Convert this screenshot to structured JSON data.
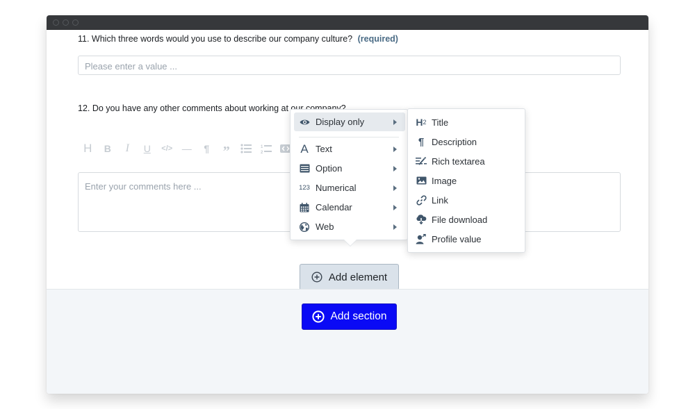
{
  "window": {
    "titlebar_dots": [
      "close",
      "minimize",
      "maximize"
    ]
  },
  "questions": [
    {
      "number_label": "11. Which three words would you use to describe our company culture?",
      "required_label": "(required)",
      "input_placeholder": "Please enter a value ..."
    },
    {
      "number_label": "12. Do you have any other comments about working at our company?",
      "textarea_placeholder": "Enter your comments here ..."
    }
  ],
  "editor_toolbar": [
    {
      "name": "heading",
      "glyph": "H"
    },
    {
      "name": "bold",
      "glyph": "B"
    },
    {
      "name": "italic",
      "glyph": "I"
    },
    {
      "name": "underline",
      "glyph": "U"
    },
    {
      "name": "code",
      "glyph": "</>"
    },
    {
      "name": "horizontal-rule",
      "glyph": "—"
    },
    {
      "name": "paragraph",
      "glyph": "¶"
    },
    {
      "name": "quote",
      "glyph": "”"
    },
    {
      "name": "bullet-list",
      "glyph": "≡"
    },
    {
      "name": "ordered-list",
      "glyph": "≡"
    },
    {
      "name": "embed",
      "glyph": "<>"
    }
  ],
  "element_menu": {
    "items": [
      {
        "label": "Display only",
        "icon": "eye-icon",
        "active": true
      },
      {
        "label": "Text",
        "icon": "text-a-icon"
      },
      {
        "label": "Option",
        "icon": "list-box-icon"
      },
      {
        "label": "Numerical",
        "icon": "123-icon"
      },
      {
        "label": "Calendar",
        "icon": "calendar-icon"
      },
      {
        "label": "Web",
        "icon": "globe-icon"
      }
    ]
  },
  "display_submenu": {
    "items": [
      {
        "label": "Title",
        "icon": "heading-h2-icon"
      },
      {
        "label": "Description",
        "icon": "paragraph-icon"
      },
      {
        "label": "Rich textarea",
        "icon": "rich-text-icon"
      },
      {
        "label": "Image",
        "icon": "image-icon"
      },
      {
        "label": "Link",
        "icon": "link-icon"
      },
      {
        "label": "File download",
        "icon": "cloud-download-icon"
      },
      {
        "label": "Profile value",
        "icon": "profile-icon"
      }
    ]
  },
  "buttons": {
    "add_element": "Add element",
    "add_section": "Add section"
  },
  "colors": {
    "primary": "#0a0af5",
    "secondary_button": "#dae2ea",
    "required_text": "#4a6b85",
    "titlebar": "#36383b"
  }
}
